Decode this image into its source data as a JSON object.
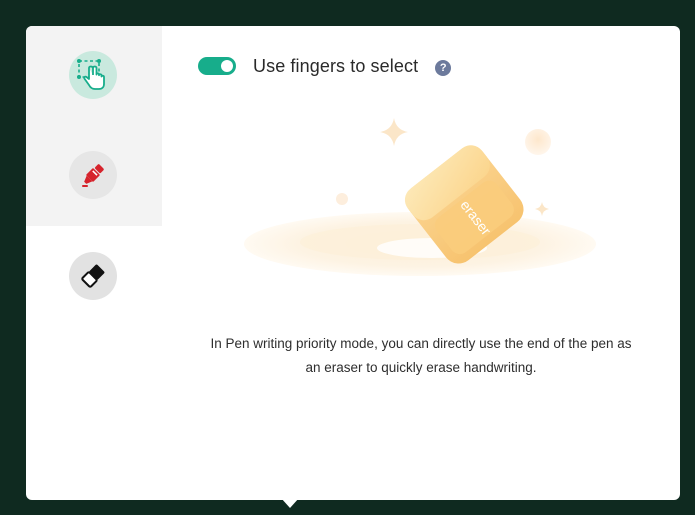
{
  "sidebar": {
    "items": [
      {
        "name": "finger-select",
        "icon": "finger-select-icon",
        "accent": "#17ad8b",
        "selected": false
      },
      {
        "name": "pen",
        "icon": "pen-icon",
        "accent": "#d6232c",
        "selected": false
      },
      {
        "name": "eraser",
        "icon": "eraser-icon",
        "accent": "#111111",
        "selected": true
      }
    ]
  },
  "toggle": {
    "label": "Use fingers to select",
    "on": true,
    "color": "#17ad8b",
    "help_symbol": "?"
  },
  "illustration": {
    "eraser_text": "eraser",
    "icon": "eraser-illustration"
  },
  "description": {
    "line1": "In Pen writing priority mode, you can directly use the end of the pen as",
    "line2": "an eraser to quickly erase handwriting."
  }
}
